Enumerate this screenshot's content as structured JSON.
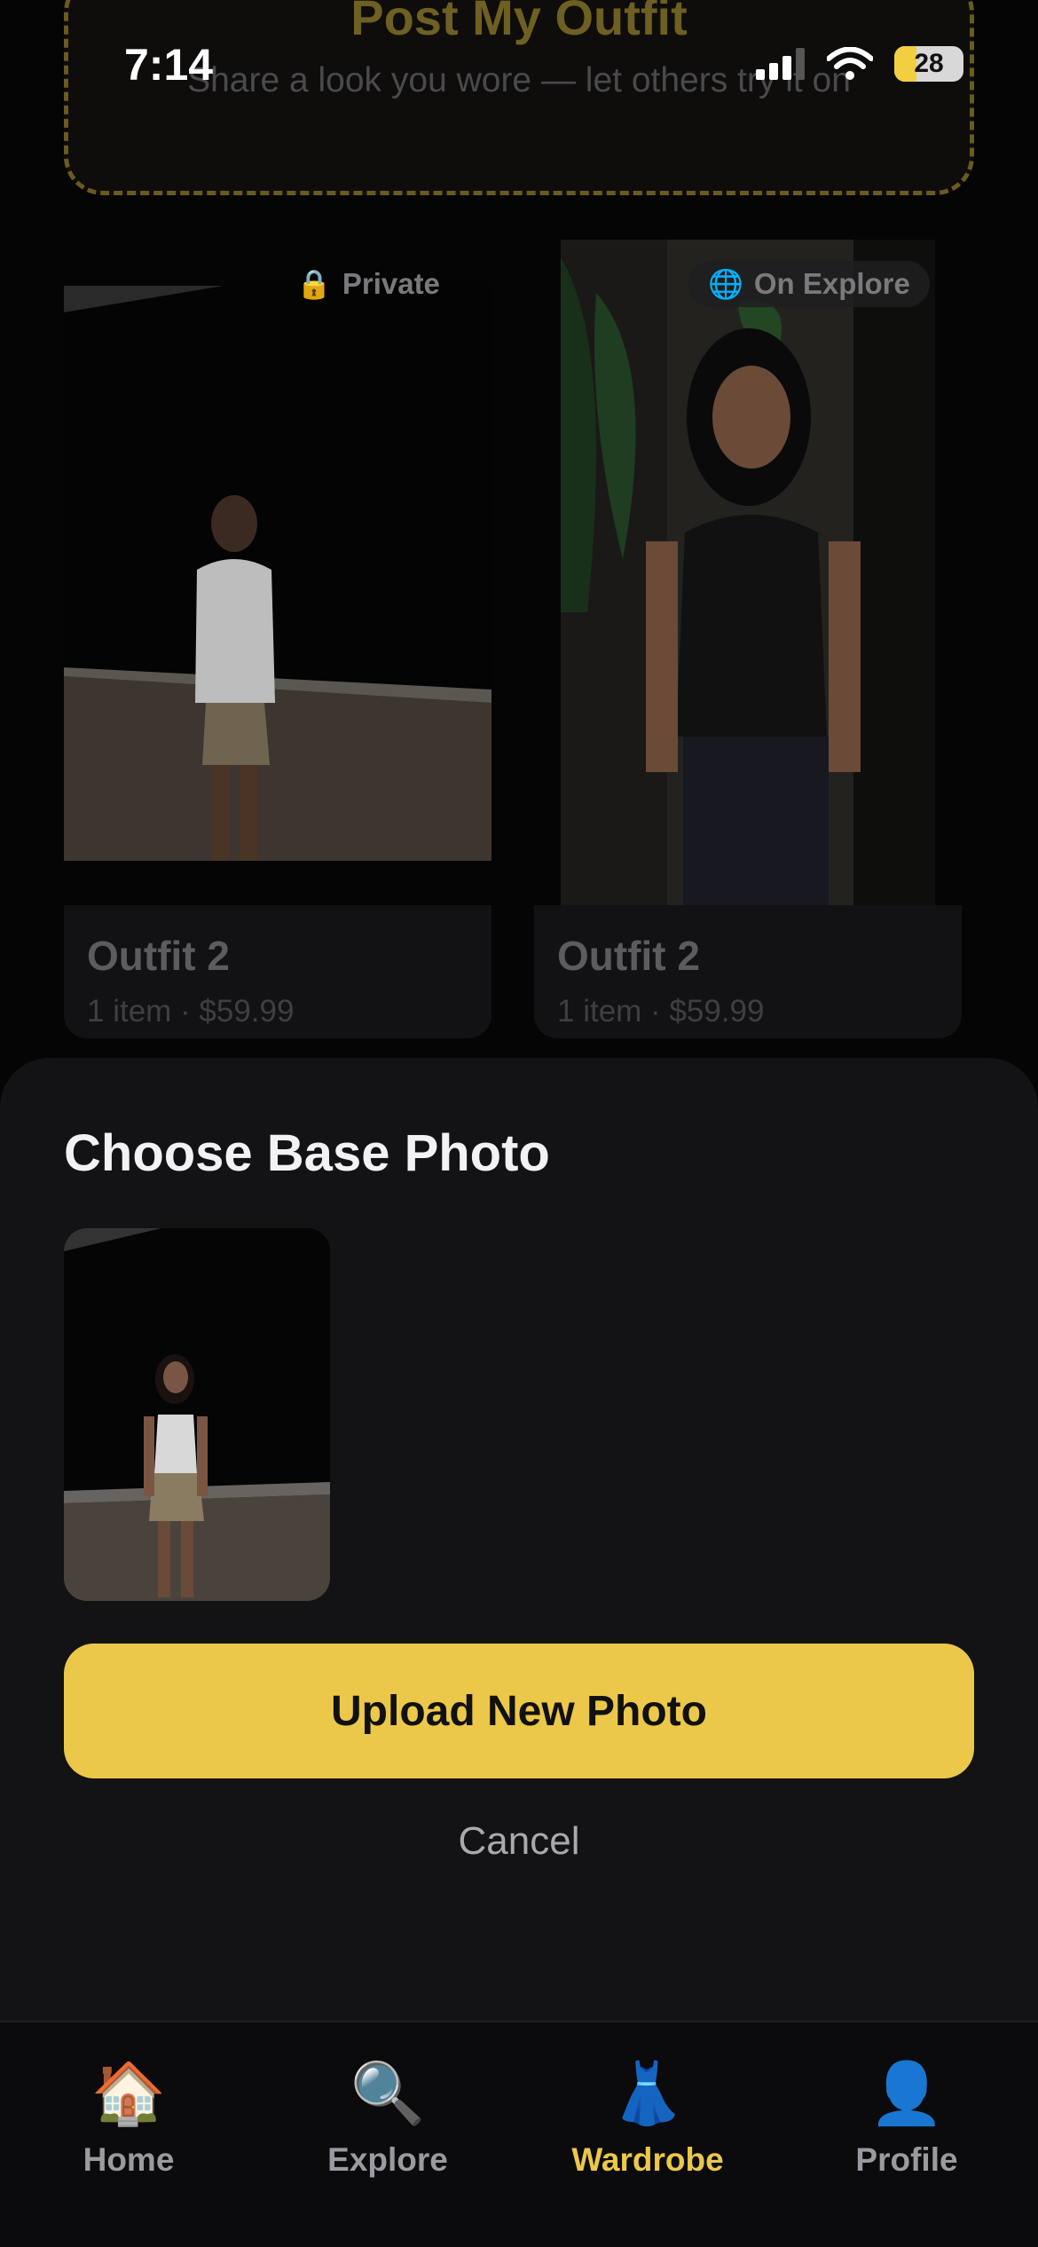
{
  "status_bar": {
    "time": "7:14",
    "battery": "28"
  },
  "post_outfit": {
    "title": "Post My Outfit",
    "subtitle": "Share a look you wore — let others try it on"
  },
  "outfits": [
    {
      "badge": "Private",
      "badge_icon": "lock-icon",
      "title": "Outfit 2",
      "meta": "1 item · $59.99"
    },
    {
      "badge": "On Explore",
      "badge_icon": "globe-icon",
      "title": "Outfit 2",
      "meta": "1 item · $59.99"
    }
  ],
  "sheet": {
    "title": "Choose Base Photo",
    "upload_label": "Upload New Photo",
    "cancel_label": "Cancel"
  },
  "tabs": [
    {
      "label": "Home",
      "icon": "house-icon"
    },
    {
      "label": "Explore",
      "icon": "magnifier-icon"
    },
    {
      "label": "Wardrobe",
      "icon": "dress-icon",
      "active": true
    },
    {
      "label": "Profile",
      "icon": "person-icon"
    }
  ],
  "colors": {
    "accent": "#ecc84a",
    "sheet_bg": "#131316",
    "background": "#050506"
  }
}
